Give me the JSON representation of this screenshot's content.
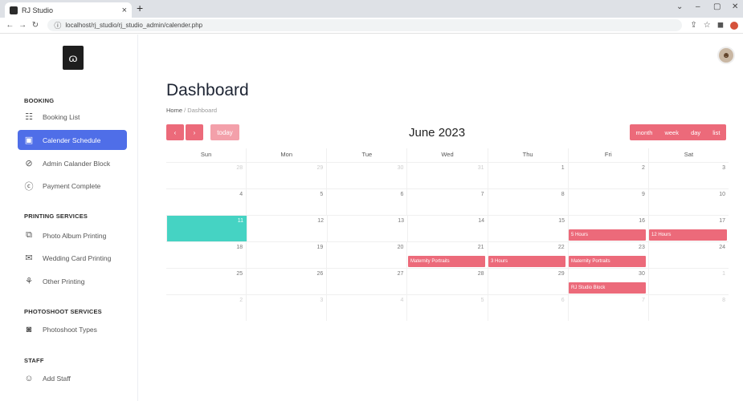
{
  "browser": {
    "tab_title": "RJ Studio",
    "url": "localhost/rj_studio/rj_studio_admin/calender.php"
  },
  "sidebar": {
    "sections": [
      {
        "title": "BOOKING",
        "items": [
          {
            "label": "Booking List",
            "icon": "booking-list-icon"
          },
          {
            "label": "Calender Schedule",
            "icon": "calendar-icon",
            "active": true
          },
          {
            "label": "Admin Calander Block",
            "icon": "block-icon"
          },
          {
            "label": "Payment Complete",
            "icon": "payment-icon"
          }
        ]
      },
      {
        "title": "PRINTING SERVICES",
        "items": [
          {
            "label": "Photo Album Printing",
            "icon": "album-icon"
          },
          {
            "label": "Wedding Card Printing",
            "icon": "card-icon"
          },
          {
            "label": "Other Printing",
            "icon": "print-icon"
          }
        ]
      },
      {
        "title": "PHOTOSHOOT SERVICES",
        "items": [
          {
            "label": "Photoshoot Types",
            "icon": "camera-icon"
          }
        ]
      },
      {
        "title": "STAFF",
        "items": [
          {
            "label": "Add Staff",
            "icon": "user-add-icon"
          }
        ]
      }
    ]
  },
  "main": {
    "title": "Dashboard",
    "breadcrumb": {
      "home": "Home",
      "sep": "/",
      "current": "Dashboard"
    },
    "calendar": {
      "title": "June 2023",
      "prev": "‹",
      "next": "›",
      "today": "today",
      "views": [
        "month",
        "week",
        "day",
        "list"
      ],
      "weekdays": [
        "Sun",
        "Mon",
        "Tue",
        "Wed",
        "Thu",
        "Fri",
        "Sat"
      ],
      "weeks": [
        [
          "28",
          "29",
          "30",
          "31",
          "1",
          "2",
          "3"
        ],
        [
          "4",
          "5",
          "6",
          "7",
          "8",
          "9",
          "10"
        ],
        [
          "11",
          "12",
          "13",
          "14",
          "15",
          "16",
          "17"
        ],
        [
          "18",
          "19",
          "20",
          "21",
          "22",
          "23",
          "24"
        ],
        [
          "25",
          "26",
          "27",
          "28",
          "29",
          "30",
          "1"
        ],
        [
          "2",
          "3",
          "4",
          "5",
          "6",
          "7",
          "8"
        ]
      ],
      "events": [
        {
          "label": "5 Hours"
        },
        {
          "label": "12 Hours"
        },
        {
          "label": "Maternity Portraits"
        },
        {
          "label": "3 Hours"
        },
        {
          "label": "Maternity Portraits"
        },
        {
          "label": "RJ Studio Block"
        }
      ]
    }
  },
  "colors": {
    "accent": "#4f6ee8",
    "event": "#ec6a7a",
    "today": "#45d3c3"
  }
}
